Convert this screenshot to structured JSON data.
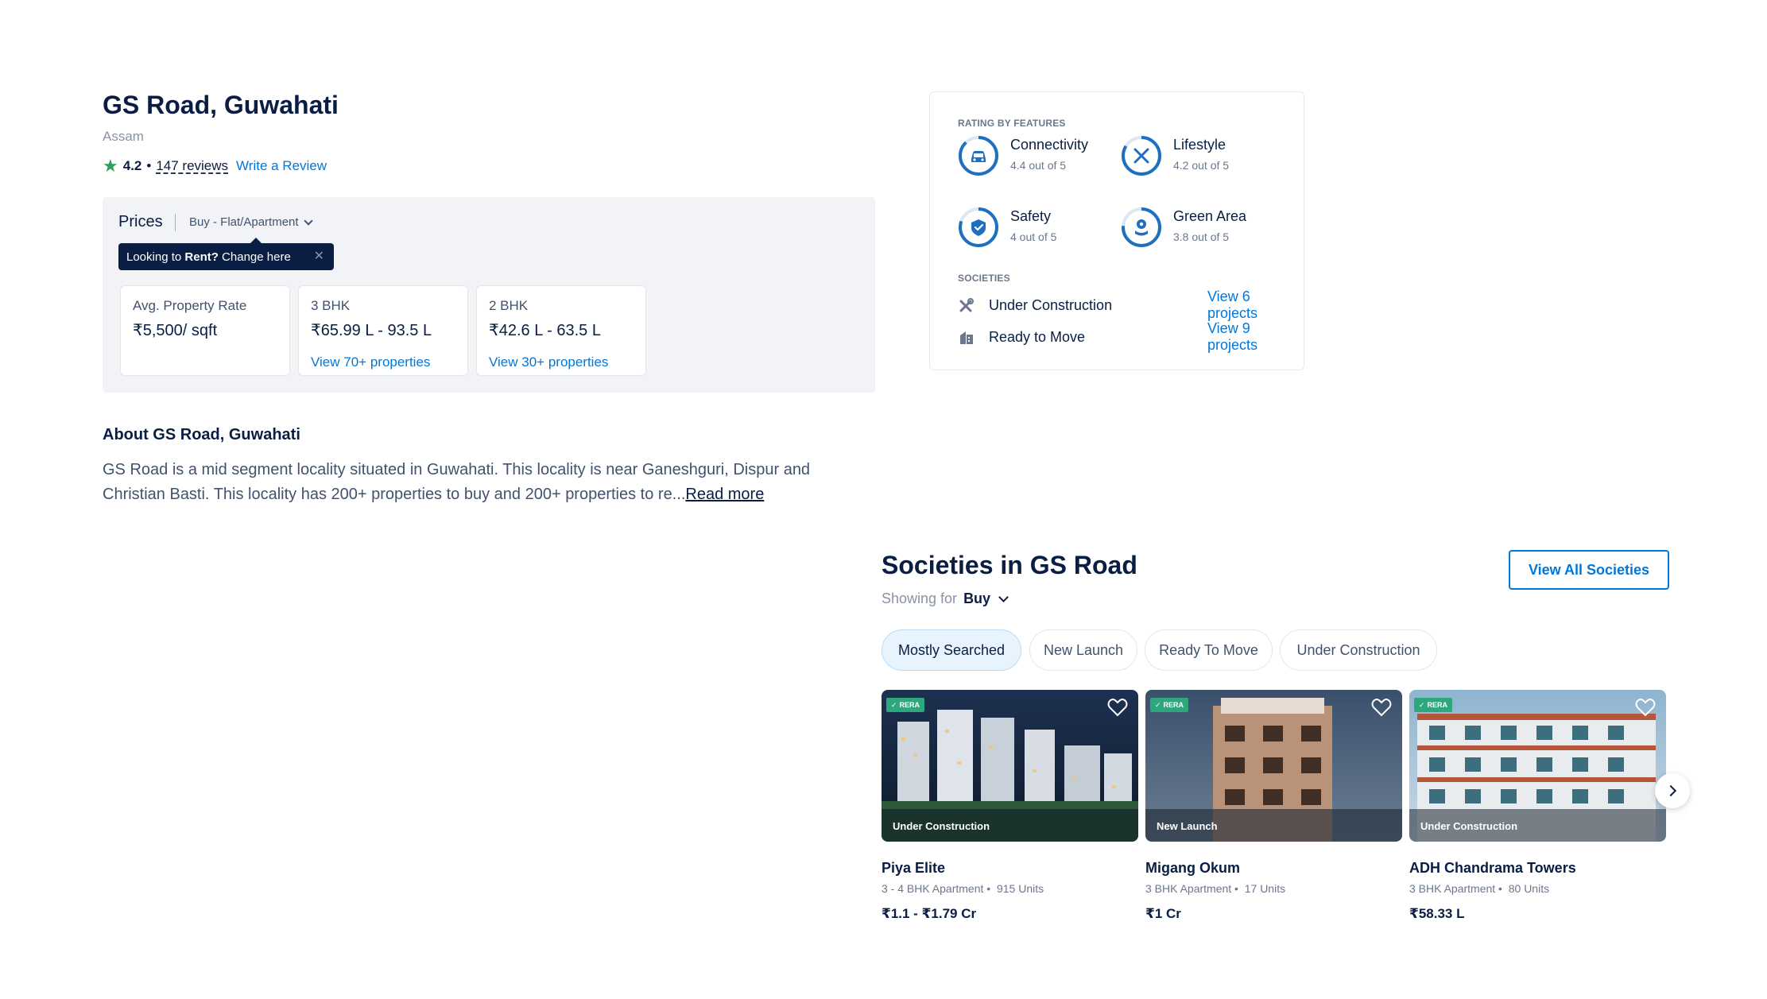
{
  "locality": {
    "title": "GS Road, Guwahati",
    "state": "Assam",
    "rating": "4.2",
    "reviews": "147 reviews",
    "write_review": "Write a Review"
  },
  "prices": {
    "label": "Prices",
    "filter": "Buy - Flat/Apartment",
    "tooltip_prefix": "Looking to ",
    "tooltip_bold": "Rent?",
    "tooltip_suffix": " Change here",
    "cards": [
      {
        "label": "Avg. Property Rate",
        "value": "₹5,500/ sqft",
        "link": ""
      },
      {
        "label": "3 BHK",
        "value": "₹65.99 L - 93.5 L",
        "link": "View 70+ properties"
      },
      {
        "label": "2 BHK",
        "value": "₹42.6 L - 63.5 L",
        "link": "View 30+ properties"
      }
    ]
  },
  "ratings": {
    "caption": "RATING BY FEATURES",
    "features": [
      {
        "name": "Connectivity",
        "score": "4.4 out of 5",
        "icon": "car-icon"
      },
      {
        "name": "Lifestyle",
        "score": "4.2 out of 5",
        "icon": "fork-knife-icon"
      },
      {
        "name": "Safety",
        "score": "4 out of 5",
        "icon": "shield-icon"
      },
      {
        "name": "Green Area",
        "score": "3.8 out of 5",
        "icon": "flower-icon"
      }
    ],
    "societies_caption": "SOCIETIES",
    "societies": [
      {
        "name": "Under Construction",
        "link": "View 6 projects",
        "icon": "tools-icon"
      },
      {
        "name": "Ready to Move",
        "link": "View 9 projects",
        "icon": "building-icon"
      }
    ]
  },
  "about": {
    "title": "About GS Road, Guwahati",
    "text": "GS Road is a mid segment locality situated in Guwahati. This locality is near Ganeshguri, Dispur and Christian Basti. This locality has 200+ properties to buy and 200+ properties to re...",
    "read_more": "Read more"
  },
  "societies": {
    "title": "Societies in GS Road",
    "showing_for": "Showing for",
    "showing_value": "Buy",
    "view_all": "View All Societies",
    "tabs": [
      "Mostly Searched",
      "New Launch",
      "Ready To Move",
      "Under Construction"
    ],
    "active_tab": "Mostly Searched",
    "projects": [
      {
        "name": "Piya Elite",
        "meta": "3 - 4 BHK Apartment •  915 Units",
        "price": "₹1.1 - ₹1.79 Cr",
        "status": "Under Construction",
        "rera": "RERA"
      },
      {
        "name": "Migang Okum",
        "meta": "3 BHK Apartment •  17 Units",
        "price": "₹1 Cr",
        "status": "New Launch",
        "rera": "RERA"
      },
      {
        "name": "ADH Chandrama Towers",
        "meta": "3 BHK Apartment •  80 Units",
        "price": "₹58.33 L",
        "status": "Under Construction",
        "rera": "RERA"
      }
    ]
  },
  "colors": {
    "primary": "#0078db",
    "text_dark": "#091e42",
    "text_muted": "#6b778c",
    "rating_star": "#2e9e5b",
    "rera_badge": "#2ea77c",
    "tooltip_bg": "#091e42",
    "chip_active_bg": "#e8f4fd"
  }
}
